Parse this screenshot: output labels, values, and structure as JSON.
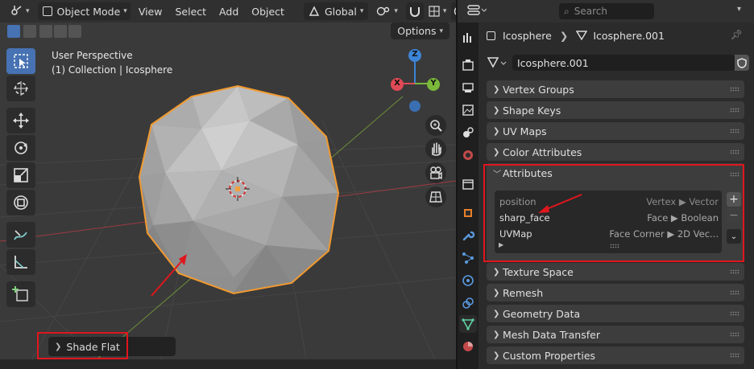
{
  "viewport": {
    "header": {
      "mode": "Object Mode",
      "menus": [
        "View",
        "Select",
        "Add",
        "Object"
      ],
      "transform_orientation": "Global"
    },
    "options_label": "Options",
    "info_line1": "User Perspective",
    "info_line2": "(1) Collection | Icosphere",
    "gizmo": {
      "z": "Z",
      "x": "X",
      "y": "Y"
    },
    "last_operator": "Shade Flat",
    "accent_color": "#4772b3",
    "selection_outline_color": "#f29a30",
    "highlight_color": "#e0161d"
  },
  "properties": {
    "search_placeholder": "Search",
    "breadcrumb": {
      "object": "Icosphere",
      "mesh": "Icosphere.001"
    },
    "mesh_name": "Icosphere.001",
    "panels_top": [
      "Vertex Groups",
      "Shape Keys",
      "UV Maps",
      "Color Attributes"
    ],
    "attributes": {
      "title": "Attributes",
      "rows": [
        {
          "name": "position",
          "domain": "Vertex ▶ Vector"
        },
        {
          "name": "sharp_face",
          "domain": "Face ▶ Boolean"
        },
        {
          "name": "UVMap",
          "domain": "Face Corner ▶ 2D Vec..."
        }
      ],
      "add": "+",
      "remove": "−"
    },
    "panels_bottom": [
      "Texture Space",
      "Remesh",
      "Geometry Data",
      "Mesh Data Transfer",
      "Custom Properties"
    ]
  }
}
